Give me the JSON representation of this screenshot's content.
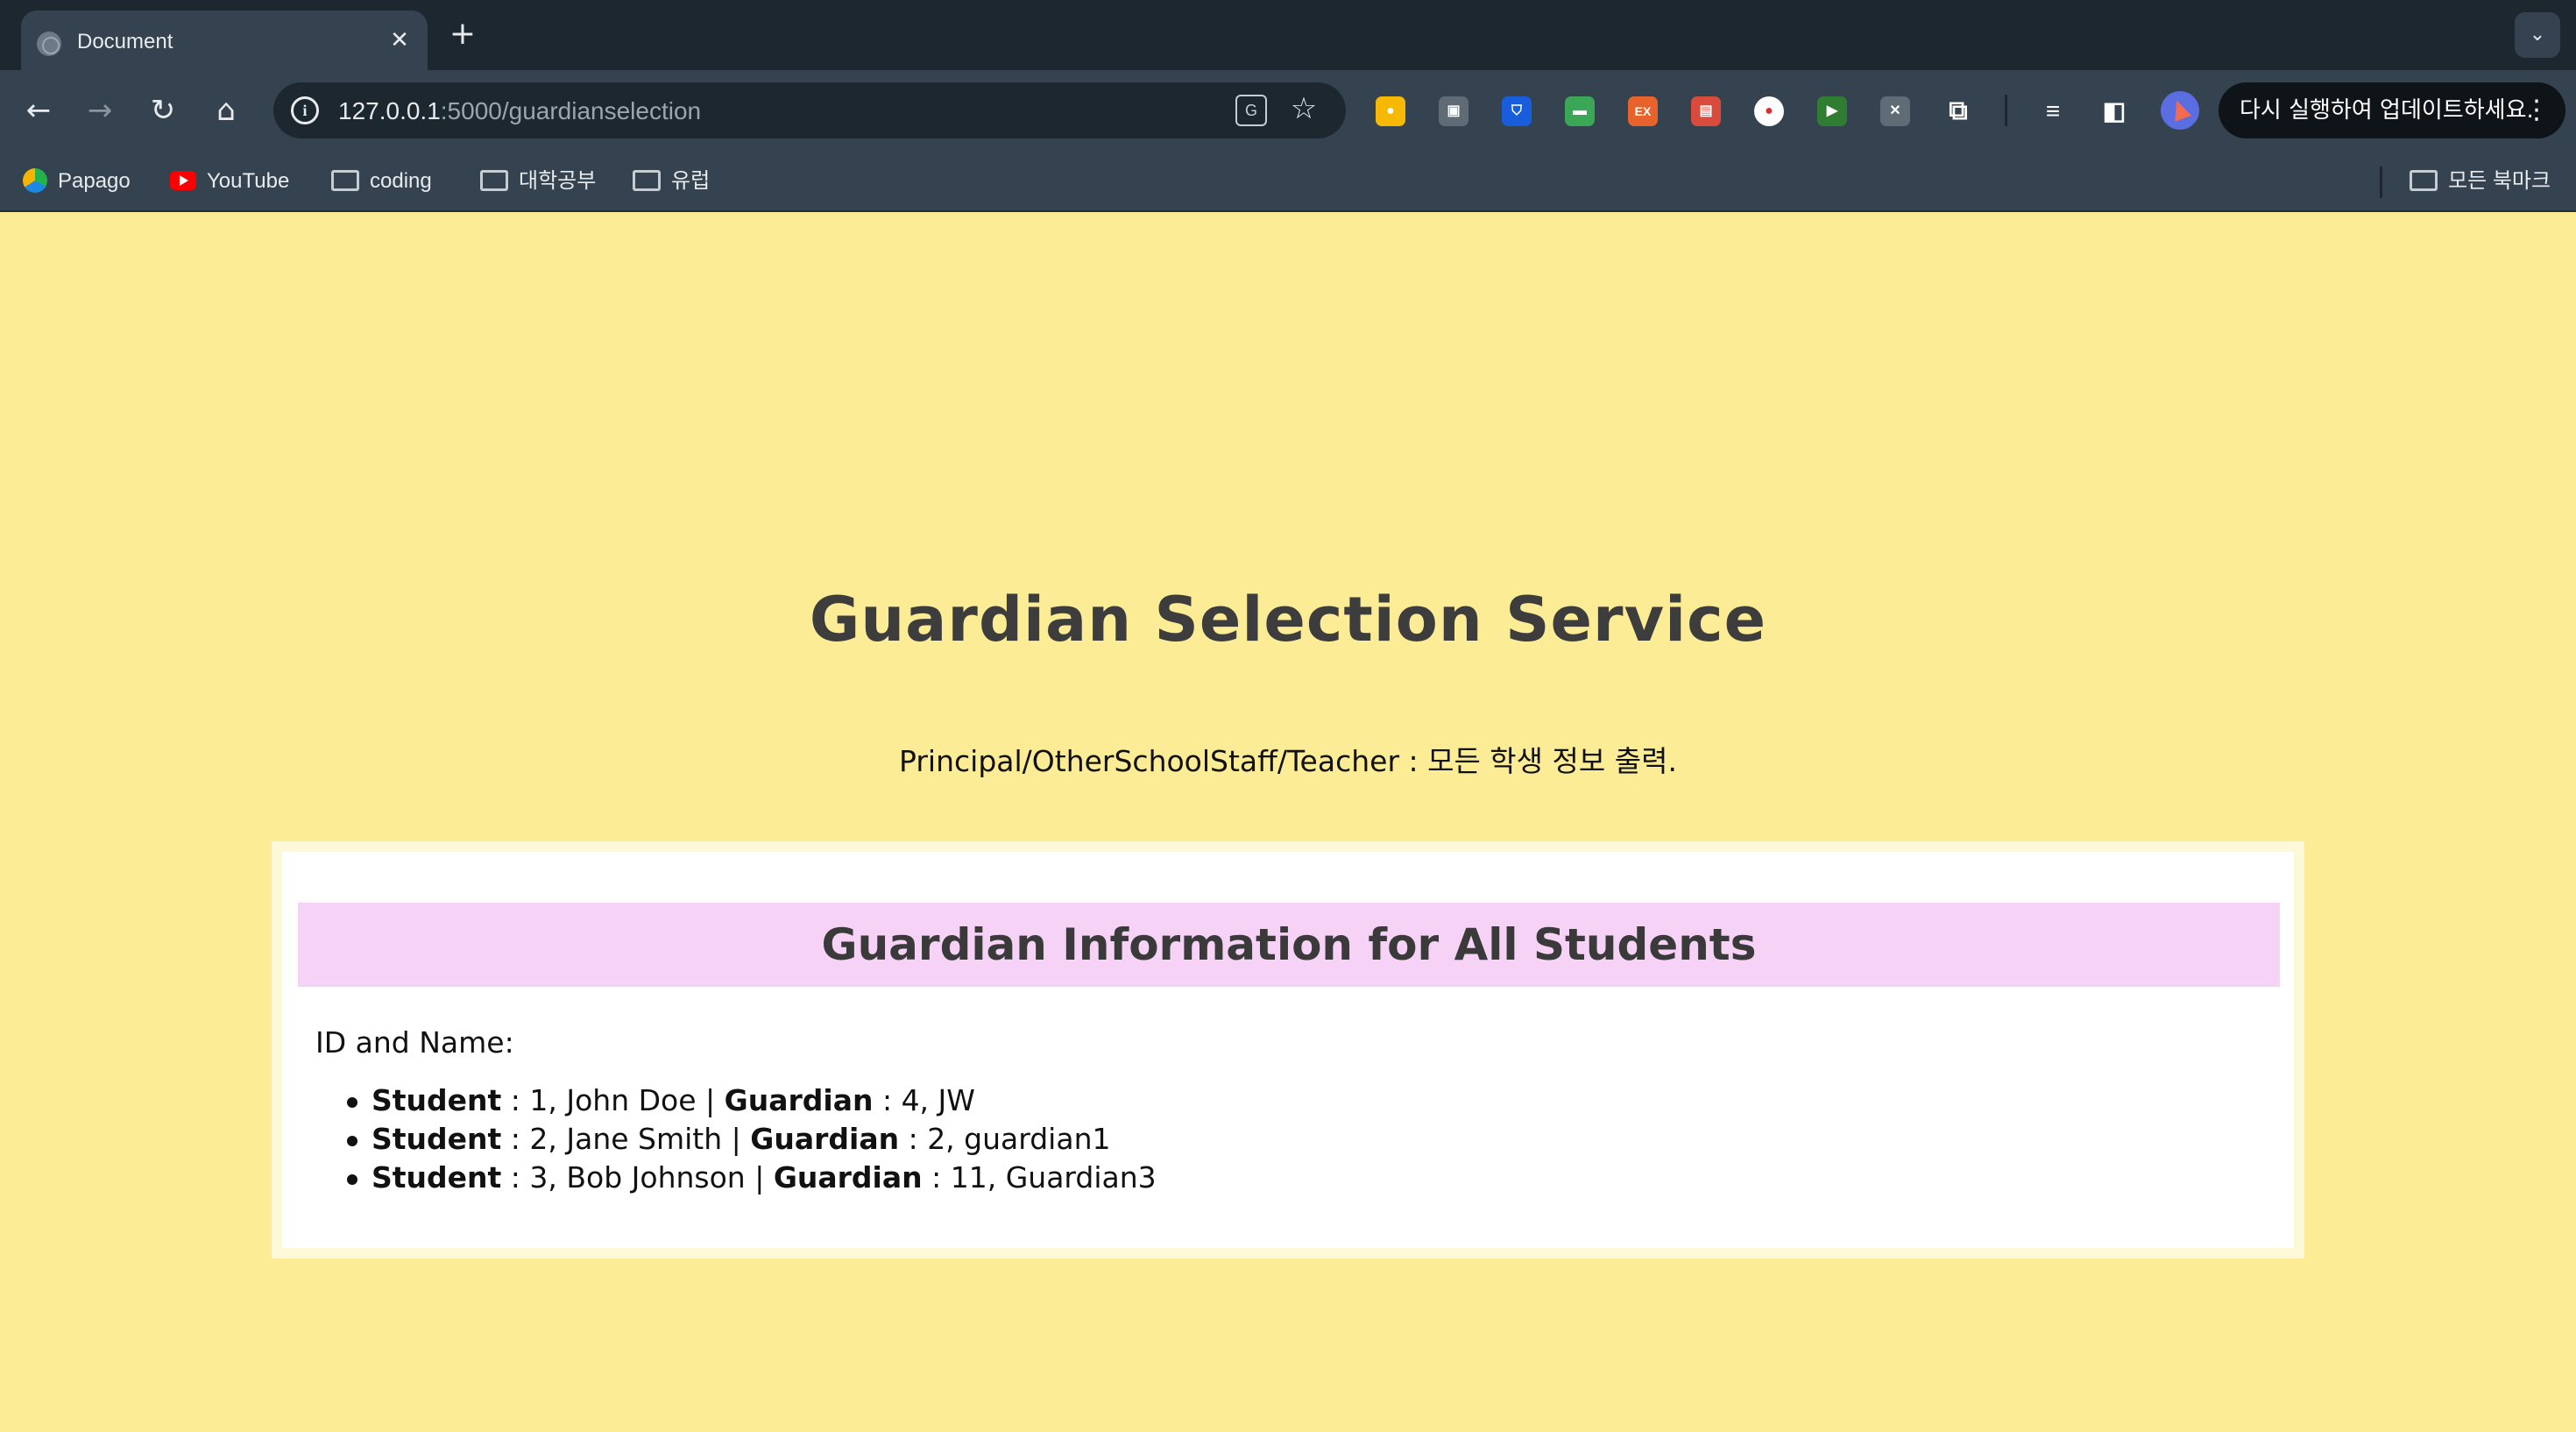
{
  "browser": {
    "tab": {
      "title": "Document"
    },
    "address": {
      "host": "127.0.0.1",
      "rest": ":5000/guardianselection"
    },
    "update_prompt": "다시 실행하여 업데이트하세요.",
    "bookmarks": [
      {
        "label": "Papago",
        "icon": "papago-icon"
      },
      {
        "label": "YouTube",
        "icon": "youtube-icon"
      },
      {
        "label": "coding",
        "icon": "folder-icon"
      },
      {
        "label": "대학공부",
        "icon": "folder-icon"
      },
      {
        "label": "유럽",
        "icon": "folder-icon"
      }
    ],
    "all_bookmarks": "모든 북마크",
    "extensions": [
      {
        "name": "keep-extension-icon",
        "color": "#f6b800"
      },
      {
        "name": "screenshot-extension-icon",
        "color": "#5f6b75"
      },
      {
        "name": "bitwarden-extension-icon",
        "color": "#175ddc"
      },
      {
        "name": "card-extension-icon",
        "color": "#3aa757"
      },
      {
        "name": "ex-extension-icon",
        "color": "#e8622c"
      },
      {
        "name": "printer-extension-icon",
        "color": "#d94c3d"
      },
      {
        "name": "record-extension-icon",
        "color": "#ffffff"
      },
      {
        "name": "media-extension-icon",
        "color": "#2e7d32"
      },
      {
        "name": "mic-off-extension-icon",
        "color": "#5f6b75"
      }
    ]
  },
  "page": {
    "title": "Guardian Selection Service",
    "subtitle": "Principal/OtherSchoolStaff/Teacher : 모든 학생 정보 출력.",
    "card": {
      "header": "Guardian Information for All Students",
      "id_label": "ID and Name:",
      "student_label": "Student",
      "guardian_label": "Guardian",
      "rows": [
        {
          "student": " : 1, John Doe | ",
          "guardian": " : 4, JW"
        },
        {
          "student": " : 2, Jane Smith | ",
          "guardian": " : 2, guardian1"
        },
        {
          "student": " : 3, Bob Johnson | ",
          "guardian": " : 11, Guardian3"
        }
      ]
    }
  },
  "colors": {
    "page_background": "#fcec96",
    "card_header_background": "#f7d2f7",
    "chrome_dark": "#1c2730",
    "chrome_toolbar": "#34434f"
  }
}
